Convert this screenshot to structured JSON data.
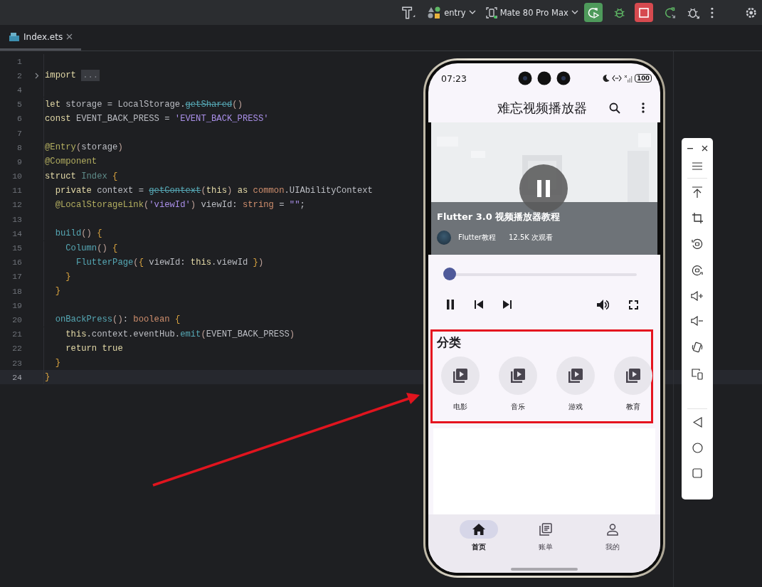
{
  "toolbar": {
    "module": "entry",
    "device": "Mate 80 Pro Max"
  },
  "tabs": [
    {
      "label": "Index.ets",
      "selected": true
    }
  ],
  "editor": {
    "lines": [
      {
        "number": "1",
        "current": false
      },
      {
        "number": "2",
        "current": false,
        "tokens": [
          {
            "kind": "keyword",
            "text": "import "
          },
          {
            "kind": "fold",
            "text": "..."
          }
        ]
      },
      {
        "number": "4",
        "current": false
      },
      {
        "number": "5",
        "current": false,
        "tokens": [
          {
            "kind": "keyword",
            "text": "let"
          },
          {
            "kind": "plain",
            "text": " storage = LocalStorage."
          },
          {
            "kind": "deprecated",
            "text": "getShared"
          },
          {
            "kind": "paren",
            "text": "()"
          }
        ]
      },
      {
        "number": "6",
        "current": false,
        "tokens": [
          {
            "kind": "keyword",
            "text": "const"
          },
          {
            "kind": "plain",
            "text": " EVENT_BACK_PRESS = "
          },
          {
            "kind": "string",
            "text": "'EVENT_BACK_PRESS'"
          }
        ]
      },
      {
        "number": "7",
        "current": false
      },
      {
        "number": "8",
        "current": false,
        "tokens": [
          {
            "kind": "decorator",
            "text": "@Entry"
          },
          {
            "kind": "paren",
            "text": "("
          },
          {
            "kind": "plain",
            "text": "storage"
          },
          {
            "kind": "paren",
            "text": ")"
          }
        ]
      },
      {
        "number": "9",
        "current": false,
        "tokens": [
          {
            "kind": "decorator",
            "text": "@Component"
          }
        ]
      },
      {
        "number": "10",
        "current": false,
        "tokens": [
          {
            "kind": "keyword",
            "text": "struct "
          },
          {
            "kind": "type",
            "text": "Index "
          },
          {
            "kind": "brace",
            "text": "{"
          }
        ]
      },
      {
        "number": "11",
        "current": false,
        "tokens": [
          {
            "kind": "keyword",
            "text": "  private"
          },
          {
            "kind": "plain",
            "text": " context = "
          },
          {
            "kind": "deprecated",
            "text": "getContext"
          },
          {
            "kind": "paren",
            "text": "("
          },
          {
            "kind": "keyword",
            "text": "this"
          },
          {
            "kind": "paren",
            "text": ") "
          },
          {
            "kind": "keyword",
            "text": "as "
          },
          {
            "kind": "builtin",
            "text": "common"
          },
          {
            "kind": "plain",
            "text": ".UIAbilityContext"
          }
        ]
      },
      {
        "number": "12",
        "current": false,
        "tokens": [
          {
            "kind": "decorator",
            "text": "  @LocalStorageLink"
          },
          {
            "kind": "paren",
            "text": "("
          },
          {
            "kind": "string",
            "text": "'viewId'"
          },
          {
            "kind": "paren",
            "text": ")"
          },
          {
            "kind": "plain",
            "text": " viewId: "
          },
          {
            "kind": "builtin",
            "text": "string"
          },
          {
            "kind": "plain",
            "text": " = "
          },
          {
            "kind": "string",
            "text": "\"\""
          },
          {
            "kind": "plain",
            "text": ";"
          }
        ]
      },
      {
        "number": "13",
        "current": false
      },
      {
        "number": "14",
        "current": false,
        "tokens": [
          {
            "kind": "function",
            "text": "  build"
          },
          {
            "kind": "paren",
            "text": "() "
          },
          {
            "kind": "brace",
            "text": "{"
          }
        ]
      },
      {
        "number": "15",
        "current": false,
        "tokens": [
          {
            "kind": "function",
            "text": "    Column"
          },
          {
            "kind": "paren",
            "text": "() "
          },
          {
            "kind": "brace",
            "text": "{"
          }
        ]
      },
      {
        "number": "16",
        "current": false,
        "tokens": [
          {
            "kind": "function",
            "text": "      FlutterPage"
          },
          {
            "kind": "paren",
            "text": "("
          },
          {
            "kind": "brace",
            "text": "{"
          },
          {
            "kind": "plain",
            "text": " viewId: "
          },
          {
            "kind": "keyword",
            "text": "this"
          },
          {
            "kind": "plain",
            "text": ".viewId "
          },
          {
            "kind": "brace",
            "text": "}"
          },
          {
            "kind": "paren",
            "text": ")"
          }
        ]
      },
      {
        "number": "17",
        "current": false,
        "tokens": [
          {
            "kind": "brace",
            "text": "    }"
          }
        ]
      },
      {
        "number": "18",
        "current": false,
        "tokens": [
          {
            "kind": "brace",
            "text": "  }"
          }
        ]
      },
      {
        "number": "19",
        "current": false
      },
      {
        "number": "20",
        "current": false,
        "tokens": [
          {
            "kind": "function",
            "text": "  onBackPress"
          },
          {
            "kind": "paren",
            "text": "()"
          },
          {
            "kind": "plain",
            "text": ": "
          },
          {
            "kind": "builtin",
            "text": "boolean "
          },
          {
            "kind": "brace",
            "text": "{"
          }
        ]
      },
      {
        "number": "21",
        "current": false,
        "tokens": [
          {
            "kind": "keyword",
            "text": "    this"
          },
          {
            "kind": "plain",
            "text": ".context.eventHub."
          },
          {
            "kind": "function",
            "text": "emit"
          },
          {
            "kind": "paren",
            "text": "("
          },
          {
            "kind": "plain",
            "text": "EVENT_BACK_PRESS"
          },
          {
            "kind": "paren",
            "text": ")"
          }
        ]
      },
      {
        "number": "22",
        "current": false,
        "tokens": [
          {
            "kind": "keyword",
            "text": "    return "
          },
          {
            "kind": "keyword",
            "text": "true"
          }
        ]
      },
      {
        "number": "23",
        "current": false,
        "tokens": [
          {
            "kind": "brace",
            "text": "  }"
          }
        ]
      },
      {
        "number": "24",
        "current": true,
        "tokens": [
          {
            "kind": "brace",
            "text": "}"
          }
        ]
      }
    ]
  },
  "phone": {
    "status_bar": {
      "time": "07:23",
      "battery": "100"
    },
    "app_bar": {
      "title": "难忘视频播放器"
    },
    "video": {
      "kind": "picture",
      "title": "Flutter 3.0 视频播放器教程",
      "channel": "Flutter教程",
      "views": "12.5K 次观看",
      "playing": true
    },
    "player": {
      "level": 0,
      "playing": true
    },
    "categories": {
      "title": "分类",
      "highlighted": true,
      "items": [
        {
          "label": "电影"
        },
        {
          "label": "音乐"
        },
        {
          "label": "游戏"
        },
        {
          "label": "教育"
        }
      ]
    },
    "bottom_nav": [
      {
        "label": "首页",
        "kind": "home",
        "selected": true
      },
      {
        "label": "账单",
        "kind": "bill",
        "selected": false
      },
      {
        "label": "我的",
        "kind": "profile",
        "selected": false
      }
    ]
  }
}
